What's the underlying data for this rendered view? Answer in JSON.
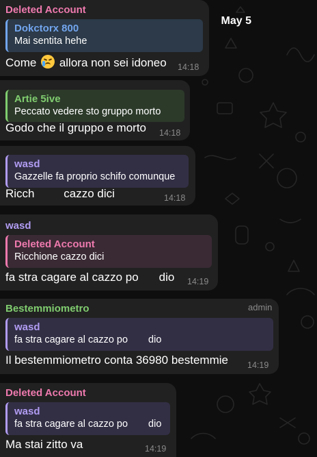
{
  "date_label": "May 5",
  "messages": [
    {
      "sender": "Deleted Account",
      "reply_name": "Dokctorx 800",
      "reply_text": "Mai sentita hehe",
      "text_before": "Come",
      "text_after": "allora non sei idoneo",
      "emoji": "loudly-crying-face",
      "time": "14:18"
    },
    {
      "reply_name": "Artie 5ive",
      "reply_text": "Peccato vedere sto gruppo morto",
      "text": "Godo che il gruppo e morto",
      "time": "14:18"
    },
    {
      "reply_name": "wasd",
      "reply_text": "Gazzelle fa proprio schifo comunque",
      "text_before": "Ricch",
      "text_after": "cazzo dici",
      "time": "14:18"
    },
    {
      "sender": "wasd",
      "reply_name": "Deleted Account",
      "reply_text": "Ricchione cazzo dici",
      "text_before": "fa stra cagare al cazzo po",
      "text_after": "dio",
      "time": "14:19"
    },
    {
      "sender": "Bestemmiometro",
      "badge": "admin",
      "reply_name": "wasd",
      "reply_text_before": "fa stra cagare al cazzo po",
      "reply_text_after": "dio",
      "text": "Il bestemmiometro conta 36980 bestemmie",
      "time": "14:19"
    },
    {
      "sender": "Deleted Account",
      "reply_name": "wasd",
      "reply_text_before": "fa stra cagare al cazzo po",
      "reply_text_after": "dio",
      "text": "Ma stai zitto va",
      "time": "14:19"
    }
  ],
  "colors": {
    "background": "#0e0e0e",
    "bubble": "#212121",
    "deleted_account": "#ee7aae",
    "dokctorx": "#72a5ee",
    "artie": "#80cd6f",
    "wasd": "#b19cf2",
    "bestemmiometro": "#80cd6f",
    "timestamp": "#8a8a8a"
  }
}
